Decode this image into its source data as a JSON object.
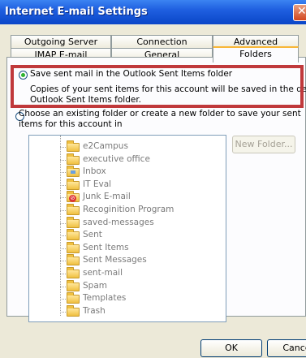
{
  "window": {
    "title": "Internet E-mail Settings"
  },
  "tabs": {
    "row_back": [
      "Outgoing Server",
      "Connection",
      "Advanced"
    ],
    "row_front": [
      "IMAP E-mail",
      "General",
      "Folders"
    ],
    "active": "Folders"
  },
  "options": {
    "save_sent": {
      "label": "Save sent mail in the Outlook Sent Items folder",
      "description_line1": "Copies of your sent items for this account will be saved in the default",
      "description_line2": "Outlook Sent Items folder.",
      "selected": true
    },
    "choose_folder": {
      "label_line1": "Choose an existing folder or create a new folder to save your sent",
      "label_line2": "items for this account in",
      "selected": false
    }
  },
  "folders": [
    {
      "name": "e2Campus",
      "icon": "folder-icon"
    },
    {
      "name": "executive office",
      "icon": "folder-icon"
    },
    {
      "name": "Inbox",
      "icon": "inbox-folder-icon"
    },
    {
      "name": "IT Eval",
      "icon": "folder-icon"
    },
    {
      "name": "Junk E-mail",
      "icon": "junk-folder-icon"
    },
    {
      "name": "Recoginition Program",
      "icon": "folder-icon"
    },
    {
      "name": "saved-messages",
      "icon": "folder-icon"
    },
    {
      "name": "Sent",
      "icon": "folder-icon"
    },
    {
      "name": "Sent Items",
      "icon": "folder-icon"
    },
    {
      "name": "Sent Messages",
      "icon": "folder-icon"
    },
    {
      "name": "sent-mail",
      "icon": "folder-icon"
    },
    {
      "name": "Spam",
      "icon": "folder-icon"
    },
    {
      "name": "Templates",
      "icon": "folder-icon"
    },
    {
      "name": "Trash",
      "icon": "folder-icon"
    }
  ],
  "buttons": {
    "new_folder": "New Folder...",
    "ok": "OK",
    "cancel": "Cancel"
  },
  "colors": {
    "titlebar": "#0a46c8",
    "highlight_box": "#c0393b",
    "active_tab_accent": "#f8b636",
    "radio_selected": "#2fb32f"
  }
}
